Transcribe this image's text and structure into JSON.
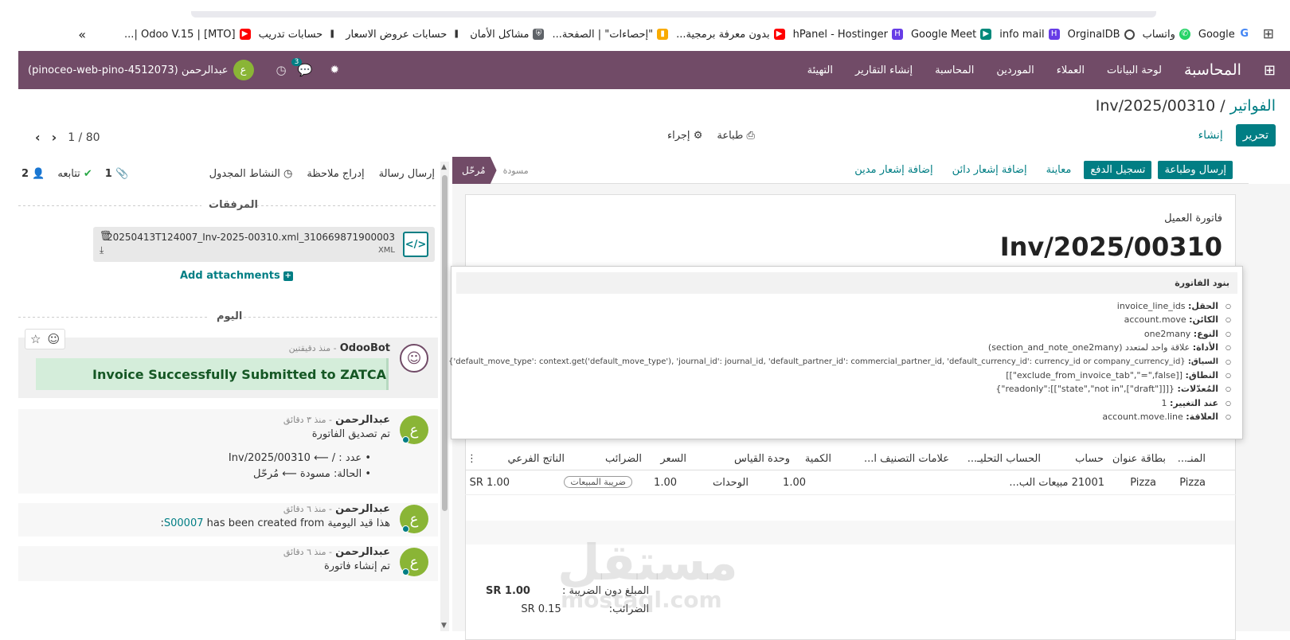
{
  "bookmarks": [
    {
      "label": "Google",
      "icon": "google-icon",
      "color": "#4285f4"
    },
    {
      "label": "واتساب",
      "icon": "whatsapp-icon",
      "color": "#25d366"
    },
    {
      "label": "OrginalDB",
      "icon": "circle-icon",
      "color": "#444444"
    },
    {
      "label": "info mail",
      "icon": "hostinger-icon",
      "color": "#673de6"
    },
    {
      "label": "Google Meet",
      "icon": "meet-icon",
      "color": "#00897b"
    },
    {
      "label": "hPanel - Hostinger",
      "icon": "hostinger-icon",
      "color": "#673de6"
    },
    {
      "label": "بدون معرفة برمجية...",
      "icon": "youtube-icon",
      "color": "#ff0000"
    },
    {
      "label": "\"إحصاءات\" | الصفحة...",
      "icon": "analytics-icon",
      "color": "#f9ab00"
    },
    {
      "label": "مشاكل الأمان",
      "icon": "shield-icon",
      "color": "#5f6368"
    },
    {
      "label": "حسابات عروض الاسعار",
      "icon": "bookmark-icon",
      "color": "#333333"
    },
    {
      "label": "حسابات تدريب",
      "icon": "bookmark-icon",
      "color": "#333333"
    },
    {
      "label": "Odoo V.15 | [MTO] |...",
      "icon": "youtube-icon",
      "color": "#ff0000"
    }
  ],
  "bookmarks_more": "»",
  "navbar": {
    "app_name": "المحاسبة",
    "menu": [
      "لوحة البيانات",
      "العملاء",
      "الموردين",
      "المحاسبة",
      "إنشاء التقارير",
      "التهيئة"
    ],
    "user": "عبدالرحمن (pinoceo-web-pino-4512073)",
    "user_initial": "ع",
    "messages_count": "3"
  },
  "breadcrumb": {
    "parent": "الفواتير",
    "current": "Inv/2025/00310"
  },
  "control": {
    "edit": "تحرير",
    "create": "إنشاء",
    "print": "طباعة",
    "action": "إجراء",
    "pager": "1 / 80"
  },
  "statusbar": {
    "buttons": [
      "إرسال وطباعة",
      "تسجيل الدفع",
      "معاينة",
      "إضافة إشعار دائن",
      "إضافة إشعار مدين"
    ],
    "stage_current": "مُرحّل",
    "stage_draft": "مسودة"
  },
  "sheet": {
    "type_label": "فاتورة العميل",
    "number": "Inv/2025/00310"
  },
  "tooltip": {
    "title": "بنود الفاتورة",
    "rows": [
      {
        "key": "الحقل:",
        "value": "invoice_line_ids"
      },
      {
        "key": "الكائن:",
        "value": "account.move"
      },
      {
        "key": "النوع:",
        "value": "one2many"
      },
      {
        "key": "الأداة:",
        "value": "علاقة واحد لمتعدد (section_and_note_one2many)"
      },
      {
        "key": "السياق:",
        "value": "{'default_move_type': context.get('default_move_type'), 'journal_id': journal_id, 'default_partner_id': commercial_partner_id, 'default_currency_id': currency_id or company_currency_id}"
      },
      {
        "key": "النطاق:",
        "value": "[[\"exclude_from_invoice_tab\",\"=\",false]]"
      },
      {
        "key": "المُعدّلات:",
        "value": "{\"readonly\":[[\"state\",\"not in\",[\"draft\"]]]}"
      },
      {
        "key": "عند التغيير:",
        "value": "1"
      },
      {
        "key": "العلاقة:",
        "value": "account.move.line"
      }
    ]
  },
  "table": {
    "headers": [
      "المنـ...",
      "بطاقة عنوان",
      "حساب",
      "الحساب التحليـ...",
      "علامات التصنيف ا...",
      "الكمية",
      "وحدة القياس",
      "السعر",
      "الضرائب",
      "الناتج الفرعي"
    ],
    "row": {
      "product": "Pizza",
      "label": "Pizza",
      "account": "21001 مبيعات الب...",
      "qty": "1.00",
      "uom": "الوحدات",
      "price": "1.00",
      "tax": "ضريبة المبيعات",
      "subtotal": "SR 1.00"
    }
  },
  "totals": {
    "untaxed_label": "المبلغ دون الضريبة :",
    "untaxed": "SR 1.00",
    "tax_label": "الضرائب:",
    "tax": "SR 0.15"
  },
  "chatter": {
    "send_message": "إرسال رسالة",
    "log_note": "إدراج ملاحظة",
    "activity": "النشاط المجدول",
    "attachments_count": "1",
    "follow": "تتابعه",
    "followers_count": "2",
    "attachments_title": "المرفقات",
    "attachment_name": "20250413T124007_Inv-2025-00310.xml_310669871900003",
    "attachment_type": "XML",
    "add_attachments": "Add attachments",
    "today": "اليوم",
    "messages": [
      {
        "author": "OdooBot",
        "time": "- منذ دقيقتين",
        "body": "Invoice Successfully Submitted to ZATCA"
      },
      {
        "author": "عبدالرحمن",
        "time": "- منذ ٣ دقائق",
        "body": "تم تصديق الفاتورة",
        "change1": "عدد : / ⟵ Inv/2025/00310",
        "change2": "الحالة: مسودة ⟵ مُرحّل"
      },
      {
        "author": "عبدالرحمن",
        "time": "- منذ ٦ دقائق",
        "body_prefix": "هذا قيد اليومية",
        "body_link": "S00007",
        "body_suffix": "has been created from:"
      },
      {
        "author": "عبدالرحمن",
        "time": "- منذ ٦ دقائق",
        "body": "تم إنشاء فاتورة"
      }
    ]
  },
  "watermark": {
    "ar": "مستقل",
    "en": "mostaql.com"
  }
}
